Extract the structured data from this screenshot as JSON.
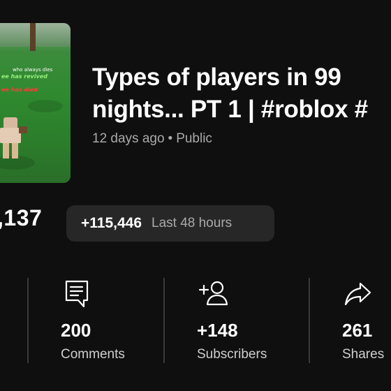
{
  "thumbnail": {
    "caption_top": "who always dies",
    "caption_revived": "ee has revived",
    "caption_died": "ee has died"
  },
  "video": {
    "title_line1": "Types of players in 99",
    "title_line2": "nights... PT 1 | #roblox #",
    "age": "12 days ago",
    "separator": "•",
    "visibility": "Public"
  },
  "views": {
    "count": ",137",
    "delta": "+115,446",
    "period": "Last 48 hours"
  },
  "stats": [
    {
      "value": "200",
      "label": "Comments",
      "icon": "comment-icon"
    },
    {
      "value": "+148",
      "label": "Subscribers",
      "icon": "add-person-icon"
    },
    {
      "value": "261",
      "label": "Shares",
      "icon": "share-icon"
    }
  ]
}
